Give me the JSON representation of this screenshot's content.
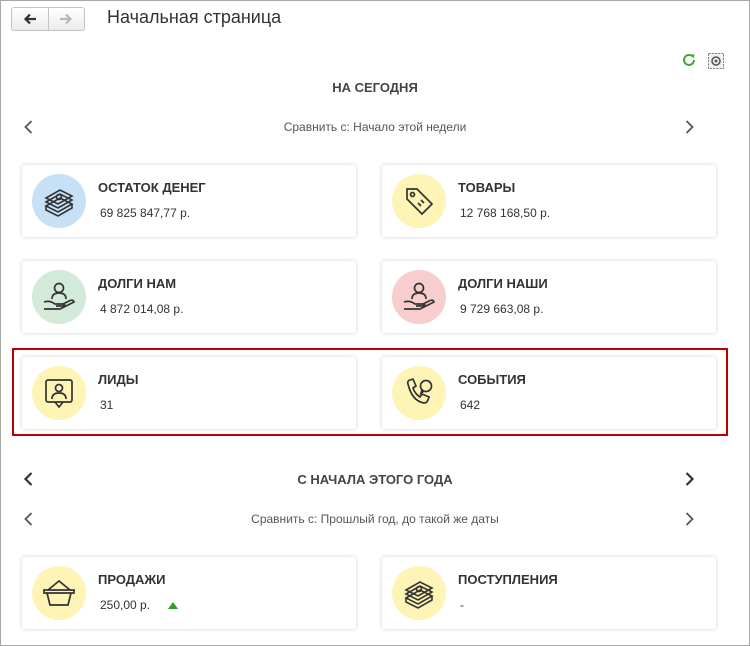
{
  "header": {
    "title": "Начальная страница",
    "back_icon": "arrow-left-icon",
    "forward_icon": "arrow-right-icon"
  },
  "toolbar": {
    "refresh_icon": "refresh-icon",
    "settings_icon": "settings-icon",
    "refresh_color": "#3aaa35"
  },
  "today": {
    "title": "НА СЕГОДНЯ",
    "compare": "Сравнить с: Начало этой недели",
    "cards": [
      {
        "title": "ОСТАТОК ДЕНЕГ",
        "value": "69 825 847,77 р.",
        "icon": "money-stack-icon",
        "color": "#c6e0f5"
      },
      {
        "title": "ТОВАРЫ",
        "value": "12 768 168,50 р.",
        "icon": "price-tag-icon",
        "color": "#fdf4b5"
      },
      {
        "title": "ДОЛГИ НАМ",
        "value": "4 872 014,08 р.",
        "icon": "hand-person-icon",
        "color": "#d4ead8"
      },
      {
        "title": "ДОЛГИ НАШИ",
        "value": "9 729 663,08 р.",
        "icon": "hand-person-icon",
        "color": "#f8cdcd"
      },
      {
        "title": "ЛИДЫ",
        "value": "31",
        "icon": "lead-person-icon",
        "color": "#fdf4b5"
      },
      {
        "title": "СОБЫТИЯ",
        "value": "642",
        "icon": "phone-chat-icon",
        "color": "#fdf4b5"
      }
    ]
  },
  "year": {
    "title": "С НАЧАЛА ЭТОГО ГОДА",
    "compare": "Сравнить с: Прошлый год, до такой же даты",
    "cards": [
      {
        "title": "ПРОДАЖИ",
        "value": "250,00 р.",
        "icon": "basket-icon",
        "color": "#fdf4b5",
        "trend": "up",
        "trend_color": "#2aa02a"
      },
      {
        "title": "ПОСТУПЛЕНИЯ",
        "value": "-",
        "icon": "money-stack-icon",
        "color": "#fdf4b5"
      }
    ]
  }
}
